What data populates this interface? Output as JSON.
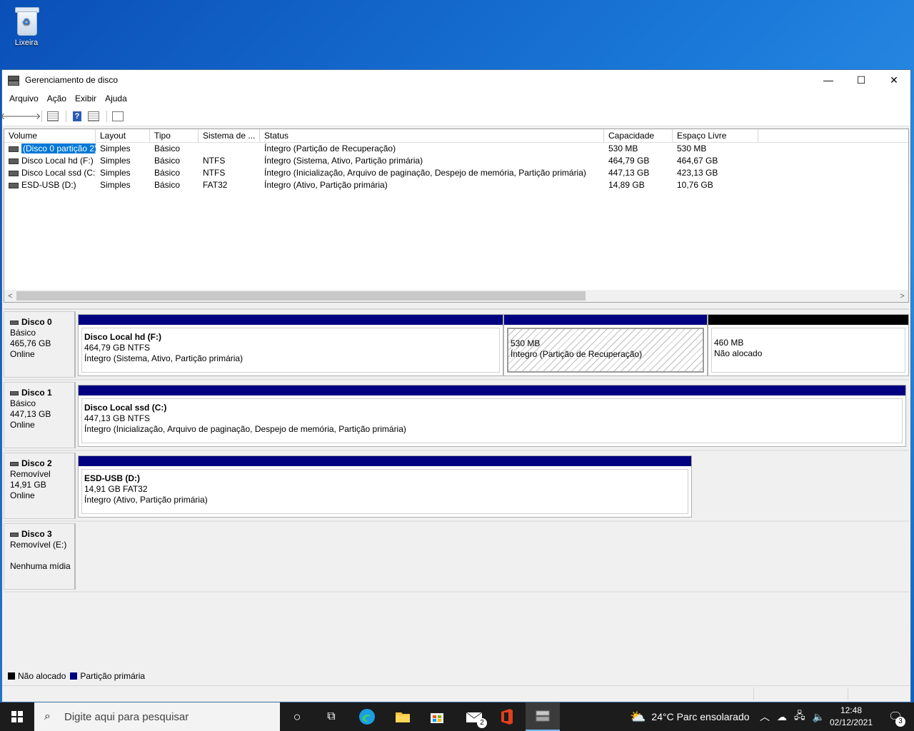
{
  "desktop": {
    "recycle_bin_label": "Lixeira"
  },
  "window": {
    "title": "Gerenciamento de disco",
    "controls": {
      "minimize": "—",
      "maximize": "☐",
      "close": "✕"
    }
  },
  "menu": [
    "Arquivo",
    "Ação",
    "Exibir",
    "Ajuda"
  ],
  "volume_table": {
    "columns": [
      "Volume",
      "Layout",
      "Tipo",
      "Sistema de ...",
      "Status",
      "Capacidade",
      "Espaço Livre"
    ],
    "rows": [
      {
        "volume": "(Disco 0 partição 2)",
        "layout": "Simples",
        "tipo": "Básico",
        "fs": "",
        "status": "Íntegro (Partição de Recuperação)",
        "capacity": "530 MB",
        "free": "530 MB"
      },
      {
        "volume": "Disco Local hd (F:)",
        "layout": "Simples",
        "tipo": "Básico",
        "fs": "NTFS",
        "status": "Íntegro (Sistema, Ativo, Partição primária)",
        "capacity": "464,79 GB",
        "free": "464,67 GB"
      },
      {
        "volume": "Disco Local ssd (C:)",
        "layout": "Simples",
        "tipo": "Básico",
        "fs": "NTFS",
        "status": "Íntegro (Inicialização, Arquivo de paginação, Despejo de memória, Partição primária)",
        "capacity": "447,13 GB",
        "free": "423,13 GB"
      },
      {
        "volume": "ESD-USB (D:)",
        "layout": "Simples",
        "tipo": "Básico",
        "fs": "FAT32",
        "status": "Íntegro (Ativo, Partição primária)",
        "capacity": "14,89 GB",
        "free": "10,76 GB"
      }
    ]
  },
  "disks": [
    {
      "name": "Disco 0",
      "type": "Básico",
      "size": "465,76 GB",
      "state": "Online",
      "partitions": [
        {
          "name": "Disco Local hd  (F:)",
          "size": "464,79 GB NTFS",
          "status": "Íntegro (Sistema, Ativo, Partição primária)"
        },
        {
          "name": "",
          "size": "530 MB",
          "status": "Íntegro (Partição de Recuperação)"
        },
        {
          "name": "",
          "size": "460 MB",
          "status": "Não alocado"
        }
      ]
    },
    {
      "name": "Disco 1",
      "type": "Básico",
      "size": "447,13 GB",
      "state": "Online",
      "partitions": [
        {
          "name": "Disco Local ssd  (C:)",
          "size": "447,13 GB NTFS",
          "status": "Íntegro (Inicialização, Arquivo de paginação, Despejo de memória, Partição primária)"
        }
      ]
    },
    {
      "name": "Disco 2",
      "type": "Removível",
      "size": "14,91 GB",
      "state": "Online",
      "partitions": [
        {
          "name": "ESD-USB  (D:)",
          "size": "14,91 GB FAT32",
          "status": "Íntegro (Ativo, Partição primária)"
        }
      ]
    },
    {
      "name": "Disco 3",
      "type": "Removível (E:)",
      "size": "",
      "state": "Nenhuma mídia",
      "partitions": []
    }
  ],
  "legend": {
    "unallocated": "Não alocado",
    "primary": "Partição primária",
    "unallocated_color": "#000000",
    "primary_color": "#000080"
  },
  "taskbar": {
    "search_placeholder": "Digite aqui para pesquisar",
    "mail_badge": "2",
    "weather": "24°C  Parc ensolarado",
    "time": "12:48",
    "date": "02/12/2021",
    "notifications_badge": "3"
  }
}
